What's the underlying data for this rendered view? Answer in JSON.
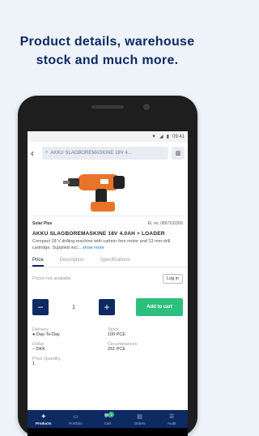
{
  "headline": {
    "line1": "Product details, warehouse",
    "line2": "stock and much more."
  },
  "status": {
    "time": "09:41"
  },
  "toolbar": {
    "search_value": "AKKU SLAGBOREMASKINE 18V 4..."
  },
  "product": {
    "brand": "Solar Plus",
    "item_no": "El. no. 0897102206",
    "title": "AKKU SLAGBOREMASKINE 18V 4.0AH + LOADER",
    "description": "Compact 18 V drilling machine with carbon-free motor and 13 mm drill cartridge. Supplied incl...",
    "more_link": "show more"
  },
  "tabs": [
    "Price",
    "Description",
    "Specifications"
  ],
  "price": {
    "unavailable_text": "Prices not available",
    "login_label": "Log in"
  },
  "quantity": {
    "minus": "−",
    "value": "1",
    "plus": "+",
    "add_to_cart": "Add to cart"
  },
  "info": [
    {
      "label": "Delivery",
      "value": "● Day-To-Day"
    },
    {
      "label": "Stock",
      "value": "100 PCE"
    },
    {
      "label": "Dollar",
      "value": "– DKK"
    },
    {
      "label": "Circumstances",
      "value": "251 PCE"
    },
    {
      "label": "Price Quantity",
      "value": "1"
    }
  ],
  "nav": [
    {
      "label": "Products",
      "icon": "products-icon"
    },
    {
      "label": "Portfolio",
      "icon": "portfolio-icon"
    },
    {
      "label": "Cart",
      "icon": "cart-icon",
      "badge": "1"
    },
    {
      "label": "Orders",
      "icon": "orders-icon"
    },
    {
      "label": "Audit",
      "icon": "audit-icon"
    }
  ],
  "colors": {
    "navy": "#0d2a63",
    "green": "#2dbf7d",
    "background": "#eef3f9"
  }
}
